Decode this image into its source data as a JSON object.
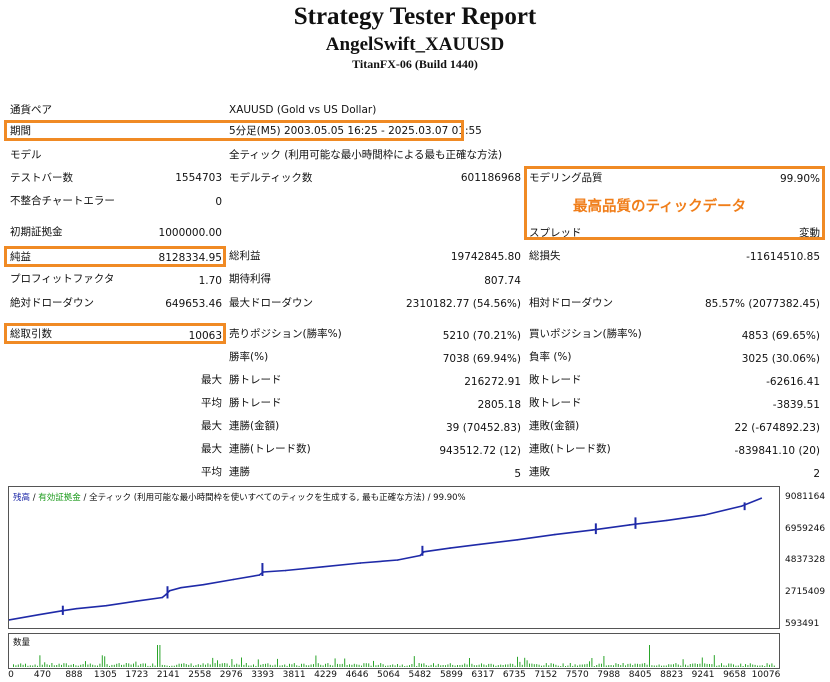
{
  "report": {
    "title": "Strategy Tester Report",
    "expert": "AngelSwift_XAUUSD",
    "server": "TitanFX-06 (Build 1440)"
  },
  "rows": {
    "symbol": {
      "label": "通貨ペア",
      "value": "XAUUSD (Gold vs US Dollar)"
    },
    "period": {
      "label": "期間",
      "value": "5分足(M5) 2003.05.05 16:25 - 2025.03.07 01:55"
    },
    "model": {
      "label": "モデル",
      "value": "全ティック (利用可能な最小時間枠による最も正確な方法)"
    },
    "bars": {
      "label": "テストバー数",
      "value": "1554703"
    },
    "ticks": {
      "label": "モデルティック数",
      "value": "601186968"
    },
    "quality": {
      "label": "モデリング品質",
      "value": "99.90%"
    },
    "mismatch": {
      "label": "不整合チャートエラー",
      "value": "0"
    },
    "deposit": {
      "label": "初期証拠金",
      "value": "1000000.00"
    },
    "spread": {
      "label": "スプレッド",
      "value": "変動"
    },
    "net_profit": {
      "label": "純益",
      "value": "8128334.95"
    },
    "gross_profit": {
      "label": "総利益",
      "value": "19742845.80"
    },
    "gross_loss": {
      "label": "総損失",
      "value": "-11614510.85"
    },
    "profit_factor": {
      "label": "プロフィットファクタ",
      "value": "1.70"
    },
    "expected_payoff": {
      "label": "期待利得",
      "value": "807.74"
    },
    "abs_dd": {
      "label": "絶対ドローダウン",
      "value": "649653.46"
    },
    "max_dd": {
      "label": "最大ドローダウン",
      "value": "2310182.77 (54.56%)"
    },
    "rel_dd": {
      "label": "相対ドローダウン",
      "value": "85.57% (2077382.45)"
    },
    "total_trades": {
      "label": "総取引数",
      "value": "10063"
    },
    "short": {
      "label": "売りポジション(勝率%)",
      "value": "5210 (70.21%)"
    },
    "long": {
      "label": "買いポジション(勝率%)",
      "value": "4853 (69.65%)"
    },
    "win_pct": {
      "label": "勝率(%)",
      "value": "7038 (69.94%)"
    },
    "loss_pct": {
      "label": "負率 (%)",
      "value": "3025 (30.06%)"
    },
    "largest": {
      "prefix": "最大",
      "win_label": "勝トレード",
      "win": "216272.91",
      "loss_label": "敗トレード",
      "loss": "-62616.41"
    },
    "average": {
      "prefix": "平均",
      "win_label": "勝トレード",
      "win": "2805.18",
      "loss_label": "敗トレード",
      "loss": "-3839.51"
    },
    "max_consec": {
      "prefix": "最大",
      "win_label": "連勝(金額)",
      "win": "39 (70452.83)",
      "loss_label": "連敗(金額)",
      "loss": "22 (-674892.23)"
    },
    "max_consec2": {
      "prefix": "最大",
      "win_label": "連勝(トレード数)",
      "win": "943512.72 (12)",
      "loss_label": "連敗(トレード数)",
      "loss": "-839841.10 (20)"
    },
    "avg_consec": {
      "prefix": "平均",
      "win_label": "連勝",
      "win": "5",
      "loss_label": "連敗",
      "loss": "2"
    }
  },
  "annotation": "最高品質のティックデータ",
  "chart_data": {
    "type": "line",
    "legend": {
      "balance": "残高",
      "sep1": " / ",
      "equity": "有効証拠金",
      "sep2": " / ",
      "model": "全ティック (利用可能な最小時間枠を使いすべてのティックを生成する, 最も正確な方法)",
      "sep3": " / ",
      "quality": "99.90%"
    },
    "y_ticks": [
      "9081164",
      "6959246",
      "4837328",
      "2715409",
      "593491"
    ],
    "y_tick_values": [
      9081164,
      6959246,
      4837328,
      2715409,
      593491
    ],
    "ylim": [
      593491,
      9611644
    ],
    "x_ticks": [
      "0",
      "470",
      "888",
      "1305",
      "1723",
      "2141",
      "2558",
      "2976",
      "3393",
      "3811",
      "4229",
      "4646",
      "5064",
      "5482",
      "5899",
      "6317",
      "6735",
      "7152",
      "7570",
      "7988",
      "8405",
      "8823",
      "9241",
      "9658",
      "10076"
    ],
    "xlim": [
      0,
      10300
    ],
    "balance": {
      "x": [
        0,
        400,
        700,
        900,
        1300,
        1700,
        2050,
        2100,
        2150,
        2300,
        2600,
        3000,
        3350,
        3400,
        3700,
        4200,
        4700,
        5200,
        5500,
        5550,
        5900,
        6300,
        6800,
        7300,
        7800,
        8300,
        8800,
        9300,
        9800,
        10063
      ],
      "y": [
        1000000,
        1350000,
        1600000,
        1750000,
        1950000,
        2250000,
        2500000,
        2700000,
        2950000,
        3150000,
        3350000,
        3700000,
        4000000,
        4200000,
        4300000,
        4550000,
        4800000,
        5000000,
        5300000,
        5550000,
        5800000,
        6050000,
        6350000,
        6700000,
        7000000,
        7350000,
        7650000,
        8000000,
        8600000,
        9128335
      ]
    },
    "equity_spikes": [
      {
        "x": 720,
        "y": 1950000
      },
      {
        "x": 2120,
        "y": 3250000
      },
      {
        "x": 3390,
        "y": 4800000
      },
      {
        "x": 5530,
        "y": 5950000
      },
      {
        "x": 7850,
        "y": 7450000
      },
      {
        "x": 8380,
        "y": 7850000
      },
      {
        "x": 9840,
        "y": 8850000
      }
    ],
    "volume_label": "数量"
  }
}
